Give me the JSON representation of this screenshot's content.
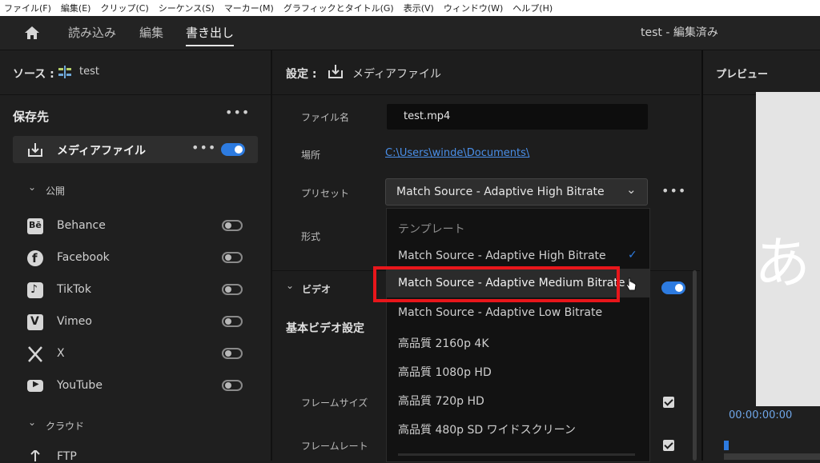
{
  "menu": [
    "ファイル(F)",
    "編集(E)",
    "クリップ(C)",
    "シーケンス(S)",
    "マーカー(M)",
    "グラフィックとタイトル(G)",
    "表示(V)",
    "ウィンドウ(W)",
    "ヘルプ(H)"
  ],
  "nav": {
    "tabs": [
      "読み込み",
      "編集",
      "書き出し"
    ],
    "active": "書き出し",
    "project_title": "test - 編集済み"
  },
  "source": {
    "label": "ソース :",
    "name": "test"
  },
  "destinations": {
    "title": "保存先",
    "media_file": "メディアファイル",
    "publish_label": "公開",
    "publish": [
      "Behance",
      "Facebook",
      "TikTok",
      "Vimeo",
      "X",
      "YouTube"
    ],
    "cloud_label": "クラウド",
    "cloud_first": "FTP"
  },
  "settings": {
    "header_label": "設定 :",
    "header_value": "メディアファイル",
    "filename_label": "ファイル名",
    "filename_value": "test.mp4",
    "location_label": "場所",
    "location_value": "C:\\Users\\winde\\Documents\\",
    "preset_label": "プリセット",
    "preset_value": "Match Source - Adaptive High Bitrate",
    "format_label": "形式",
    "video_label": "ビデオ",
    "basic_video_label": "基本ビデオ設定",
    "frame_size_label": "フレームサイズ",
    "frame_rate_label": "フレームレート"
  },
  "dropdown": {
    "header": "テンプレート",
    "options": [
      "Match Source - Adaptive High Bitrate",
      "Match Source - Adaptive Medium Bitrate",
      "Match Source - Adaptive Low Bitrate",
      "高品質 2160p 4K",
      "高品質 1080p HD",
      "高品質 720p HD",
      "高品質 480p SD ワイドスクリーン"
    ],
    "selected": "Match Source - Adaptive High Bitrate",
    "highlighted": "Match Source - Adaptive Medium Bitrate"
  },
  "preview": {
    "title": "プレビュー",
    "timecode": "00:00:00:00",
    "frame_text": "あと"
  },
  "colors": {
    "accent": "#2d7be0",
    "highlight_box": "#e8161b",
    "link": "#4a8fe8"
  }
}
